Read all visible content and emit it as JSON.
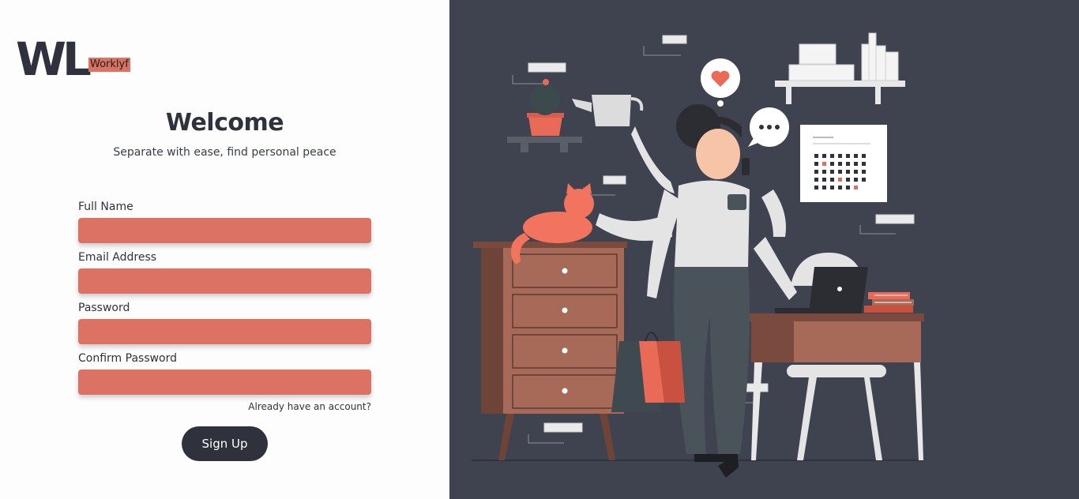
{
  "brand": {
    "mark": "WL",
    "name": "Worklyf"
  },
  "header": {
    "title": "Welcome",
    "subtitle": "Separate with ease, find personal peace"
  },
  "form": {
    "fields": [
      {
        "label": "Full Name",
        "value": "",
        "placeholder": ""
      },
      {
        "label": "Email Address",
        "value": "",
        "placeholder": ""
      },
      {
        "label": "Password",
        "value": "",
        "placeholder": ""
      },
      {
        "label": "Confirm Password",
        "value": "",
        "placeholder": ""
      }
    ],
    "login_link": "Already have an account?",
    "submit_label": "Sign Up"
  },
  "colors": {
    "accent": "#dc7263",
    "dark": "#2f323d",
    "panel": "#3f4350"
  }
}
